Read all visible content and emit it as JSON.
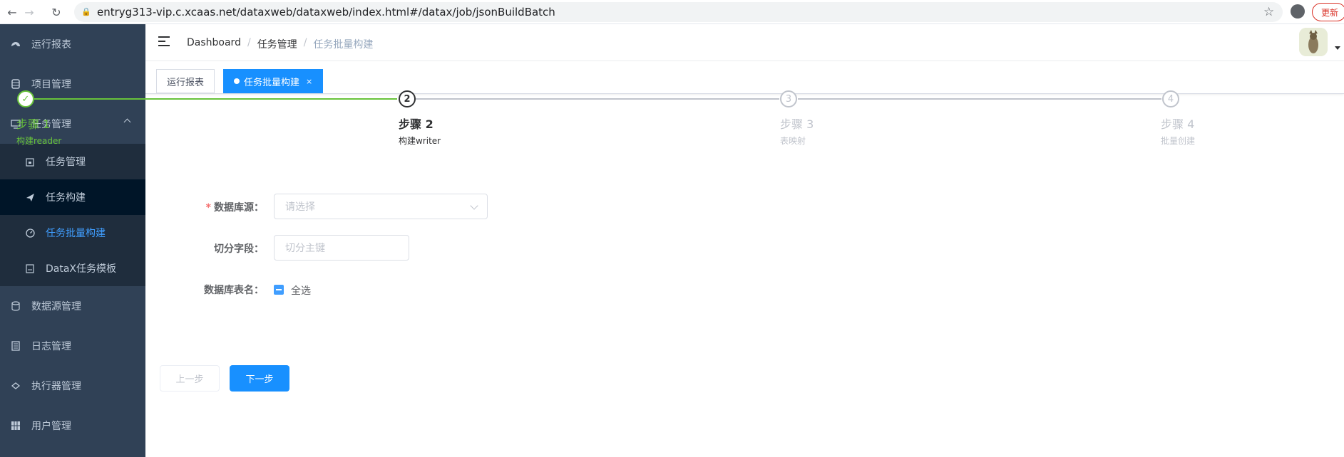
{
  "browser": {
    "url": "entryg313-vip.c.xcaas.net/dataxweb/dataxweb/index.html#/datax/job/jsonBuildBatch",
    "update_label": "更新"
  },
  "sidebar": {
    "items": [
      {
        "label": "运行报表",
        "icon": "dashboard-icon"
      },
      {
        "label": "项目管理",
        "icon": "database-icon"
      },
      {
        "label": "任务管理",
        "icon": "monitor-icon"
      },
      {
        "label": "数据源管理",
        "icon": "datasource-icon"
      },
      {
        "label": "日志管理",
        "icon": "log-icon"
      },
      {
        "label": "执行器管理",
        "icon": "executor-icon"
      },
      {
        "label": "用户管理",
        "icon": "user-grid-icon"
      }
    ],
    "sub_items": [
      {
        "label": "任务管理",
        "icon": "calendar-icon"
      },
      {
        "label": "任务构建",
        "icon": "send-icon"
      },
      {
        "label": "任务批量构建",
        "icon": "batch-icon"
      },
      {
        "label": "DataX任务模板",
        "icon": "template-icon"
      }
    ]
  },
  "breadcrumb": {
    "items": [
      "Dashboard",
      "任务管理",
      "任务批量构建"
    ],
    "sep": "/"
  },
  "tags": [
    {
      "label": "运行报表"
    },
    {
      "label": "任务批量构建",
      "close": "×"
    }
  ],
  "steps": [
    {
      "number": "✓",
      "title": "步骤 1",
      "desc": "构建reader",
      "status": "done"
    },
    {
      "number": "2",
      "title": "步骤 2",
      "desc": "构建writer",
      "status": "process"
    },
    {
      "number": "3",
      "title": "步骤 3",
      "desc": "表映射",
      "status": "wait"
    },
    {
      "number": "4",
      "title": "步骤 4",
      "desc": "批量创建",
      "status": "wait"
    }
  ],
  "form": {
    "datasource_label": "数据库源：",
    "datasource_required": "*",
    "datasource_placeholder": "请选择",
    "split_label": "切分字段：",
    "split_placeholder": "切分主键",
    "tables_label": "数据库表名：",
    "checkall_label": "全选"
  },
  "buttons": {
    "prev": "上一步",
    "next": "下一步"
  },
  "colors": {
    "sidebar_bg": "#304156",
    "accent": "#1890ff",
    "success": "#67c23a"
  }
}
